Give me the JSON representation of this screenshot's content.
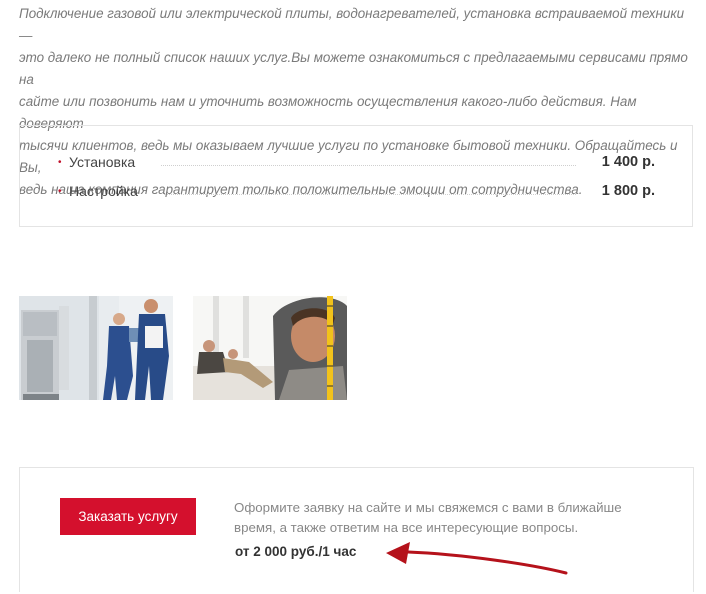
{
  "intro": {
    "line1": "Подключение газовой или электрической плиты, водонагревателей, установка встраиваемой техники —",
    "line2": "это далеко не полный список наших услуг.Вы можете ознакомиться с предлагаемыми сервисами прямо на",
    "line3": "сайте или позвонить нам и уточнить возможность осуществления какого-либо действия. Нам доверяют",
    "line4": "тысячи клиентов, ведь мы оказываем лучшие услуги по установке бытовой техники. Обращайтесь и Вы,",
    "line5": "ведь наша компания гарантирует только положительные эмоции от сотрудничества."
  },
  "prices": [
    {
      "name": "Установка",
      "price": "1 400 р."
    },
    {
      "name": "Настройка",
      "price": "1 800 р."
    }
  ],
  "order": {
    "button_label": "Заказать услугу",
    "text": "Оформите заявку на сайте и мы свяжемся с вами в ближайше время, а также ответим на все интересующие вопросы.",
    "price": "от 2 000 руб./1 час"
  },
  "colors": {
    "accent": "#d4102d",
    "arrow": "#b5121b"
  },
  "images": [
    {
      "icon": "workers-boiler-photo"
    },
    {
      "icon": "worker-measuring-tape-photo"
    }
  ]
}
